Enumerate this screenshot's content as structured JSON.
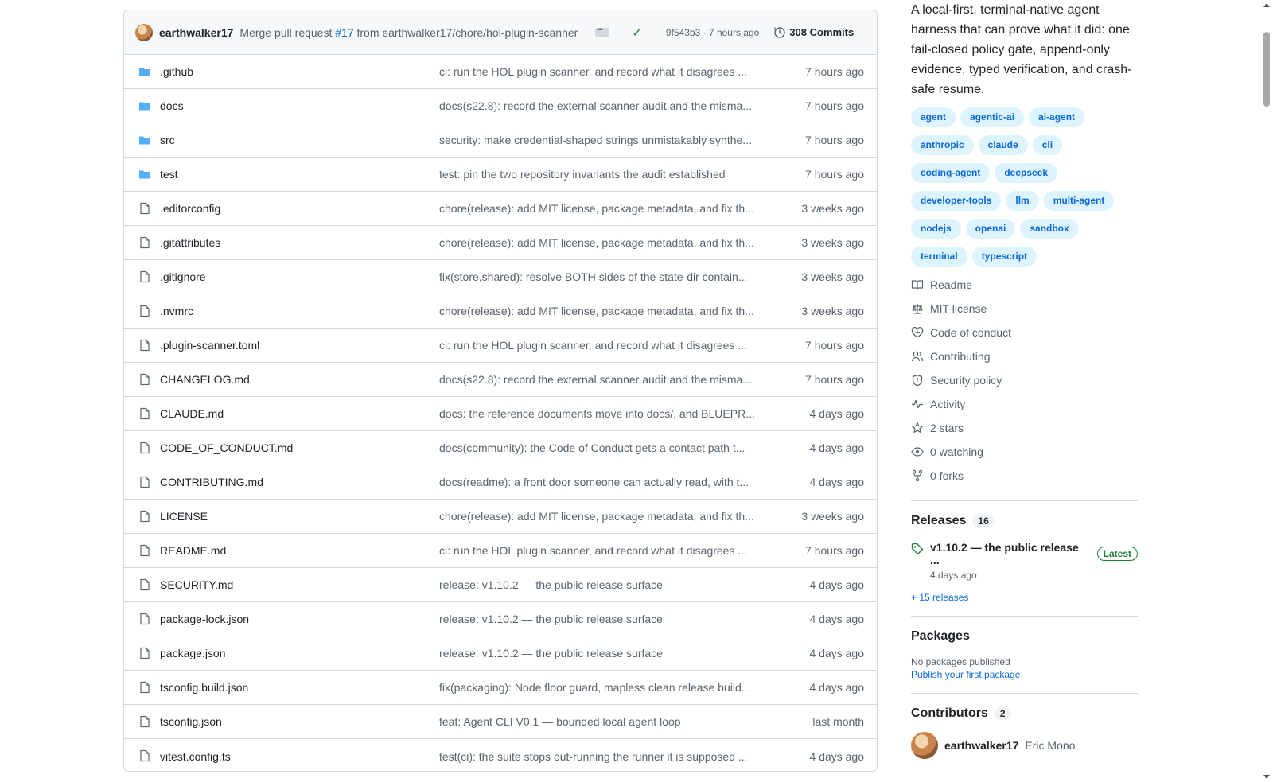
{
  "commit": {
    "author": "earthwalker17",
    "message_prefix": "Merge pull request ",
    "pr": "#17",
    "message_suffix": " from earthwalker17/chore/hol-plugin-scanner",
    "sha_age": "9f543b3 · 7 hours ago",
    "commits_label": "308 Commits"
  },
  "files": [
    {
      "name": ".github",
      "type": "folder",
      "message": "ci: run the HOL plugin scanner, and record what it disagrees ...",
      "age": "7 hours ago"
    },
    {
      "name": "docs",
      "type": "folder",
      "message": "docs(s22.8): record the external scanner audit and the misma...",
      "age": "7 hours ago"
    },
    {
      "name": "src",
      "type": "folder",
      "message": "security: make credential-shaped strings unmistakably synthe...",
      "age": "7 hours ago"
    },
    {
      "name": "test",
      "type": "folder",
      "message": "test: pin the two repository invariants the audit established",
      "age": "7 hours ago"
    },
    {
      "name": ".editorconfig",
      "type": "file",
      "message": "chore(release): add MIT license, package metadata, and fix th...",
      "age": "3 weeks ago"
    },
    {
      "name": ".gitattributes",
      "type": "file",
      "message": "chore(release): add MIT license, package metadata, and fix th...",
      "age": "3 weeks ago"
    },
    {
      "name": ".gitignore",
      "type": "file",
      "message": "fix(store,shared): resolve BOTH sides of the state-dir contain...",
      "age": "3 weeks ago"
    },
    {
      "name": ".nvmrc",
      "type": "file",
      "message": "chore(release): add MIT license, package metadata, and fix th...",
      "age": "3 weeks ago"
    },
    {
      "name": ".plugin-scanner.toml",
      "type": "file",
      "message": "ci: run the HOL plugin scanner, and record what it disagrees ...",
      "age": "7 hours ago"
    },
    {
      "name": "CHANGELOG.md",
      "type": "file",
      "message": "docs(s22.8): record the external scanner audit and the misma...",
      "age": "7 hours ago"
    },
    {
      "name": "CLAUDE.md",
      "type": "file",
      "message": "docs: the reference documents move into docs/, and BLUEPR...",
      "age": "4 days ago"
    },
    {
      "name": "CODE_OF_CONDUCT.md",
      "type": "file",
      "message": "docs(community): the Code of Conduct gets a contact path t...",
      "age": "4 days ago"
    },
    {
      "name": "CONTRIBUTING.md",
      "type": "file",
      "message": "docs(readme): a front door someone can actually read, with t...",
      "age": "4 days ago"
    },
    {
      "name": "LICENSE",
      "type": "file",
      "message": "chore(release): add MIT license, package metadata, and fix th...",
      "age": "3 weeks ago"
    },
    {
      "name": "README.md",
      "type": "file",
      "message": "ci: run the HOL plugin scanner, and record what it disagrees ...",
      "age": "7 hours ago"
    },
    {
      "name": "SECURITY.md",
      "type": "file",
      "message": "release: v1.10.2 — the public release surface",
      "age": "4 days ago"
    },
    {
      "name": "package-lock.json",
      "type": "file",
      "message": "release: v1.10.2 — the public release surface",
      "age": "4 days ago"
    },
    {
      "name": "package.json",
      "type": "file",
      "message": "release: v1.10.2 — the public release surface",
      "age": "4 days ago"
    },
    {
      "name": "tsconfig.build.json",
      "type": "file",
      "message": "fix(packaging): Node floor guard, mapless clean release build...",
      "age": "4 days ago"
    },
    {
      "name": "tsconfig.json",
      "type": "file",
      "message": "feat: Agent CLI V0.1 — bounded local agent loop",
      "age": "last month"
    },
    {
      "name": "vitest.config.ts",
      "type": "file",
      "message": "test(ci): the suite stops out-running the runner it is supposed ...",
      "age": "4 days ago"
    }
  ],
  "about": {
    "description": "A local-first, terminal-native agent harness that can prove what it did: one fail-closed policy gate, append-only evidence, typed verification, and crash-safe resume.",
    "topics": [
      "agent",
      "agentic-ai",
      "ai-agent",
      "anthropic",
      "claude",
      "cli",
      "coding-agent",
      "deepseek",
      "developer-tools",
      "llm",
      "multi-agent",
      "nodejs",
      "openai",
      "sandbox",
      "terminal",
      "typescript"
    ],
    "links": [
      {
        "icon": "book-icon",
        "label": "Readme"
      },
      {
        "icon": "scale-icon",
        "label": "MIT license"
      },
      {
        "icon": "heart-icon",
        "label": "Code of conduct"
      },
      {
        "icon": "people-icon",
        "label": "Contributing"
      },
      {
        "icon": "shield-icon",
        "label": "Security policy"
      },
      {
        "icon": "pulse-icon",
        "label": "Activity"
      },
      {
        "icon": "star-icon",
        "label": "2 stars"
      },
      {
        "icon": "eye-icon",
        "label": "0 watching"
      },
      {
        "icon": "fork-icon",
        "label": "0 forks"
      }
    ]
  },
  "releases": {
    "title": "Releases",
    "count": "16",
    "latest_name": "v1.10.2 — the public release ...",
    "latest_badge": "Latest",
    "latest_date": "4 days ago",
    "more": "+ 15 releases"
  },
  "packages": {
    "title": "Packages",
    "none": "No packages published",
    "publish_link": "Publish your first package"
  },
  "contributors": {
    "title": "Contributors",
    "count": "2",
    "login": "earthwalker17",
    "name": "Eric Mono"
  },
  "colors": {
    "accent": "#0969da",
    "success": "#1a7f37",
    "folder": "#54aeff"
  }
}
